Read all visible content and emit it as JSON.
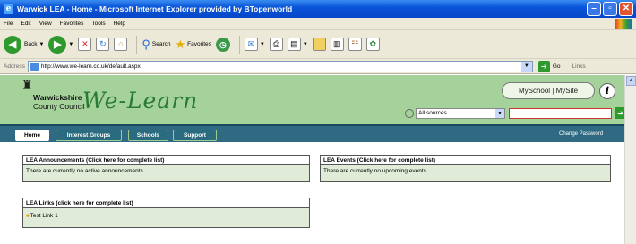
{
  "window": {
    "title": "Warwick LEA - Home - Microsoft Internet Explorer provided by BTopenworld"
  },
  "menu": [
    "File",
    "Edit",
    "View",
    "Favorites",
    "Tools",
    "Help"
  ],
  "toolbar": {
    "back": "Back",
    "search": "Search",
    "favorites": "Favorites"
  },
  "address": {
    "label": "Address",
    "url": "http://www.we-learn.co.uk/default.aspx",
    "go": "Go",
    "links": "Links"
  },
  "site": {
    "council_line1": "Warwickshire",
    "council_line2": "County Council",
    "brand": "We-Learn",
    "myschool": "MySchool",
    "divider": "|",
    "mysite": "MySite",
    "info": "i",
    "search_scope": "All sources",
    "search_value": ""
  },
  "nav": {
    "tabs": [
      "Home",
      "Interest Groups",
      "Schools",
      "Support"
    ],
    "change_password": "Change Password"
  },
  "panels": {
    "announcements": {
      "title": "LEA Announcements (Click here for complete list)",
      "body": "There are currently no active announcements."
    },
    "events": {
      "title": "LEA Events (Click here for complete list)",
      "body": "There are currently no upcoming events."
    },
    "links": {
      "title": "LEA Links (click here for complete list)",
      "items": [
        "Test Link 1"
      ]
    }
  }
}
